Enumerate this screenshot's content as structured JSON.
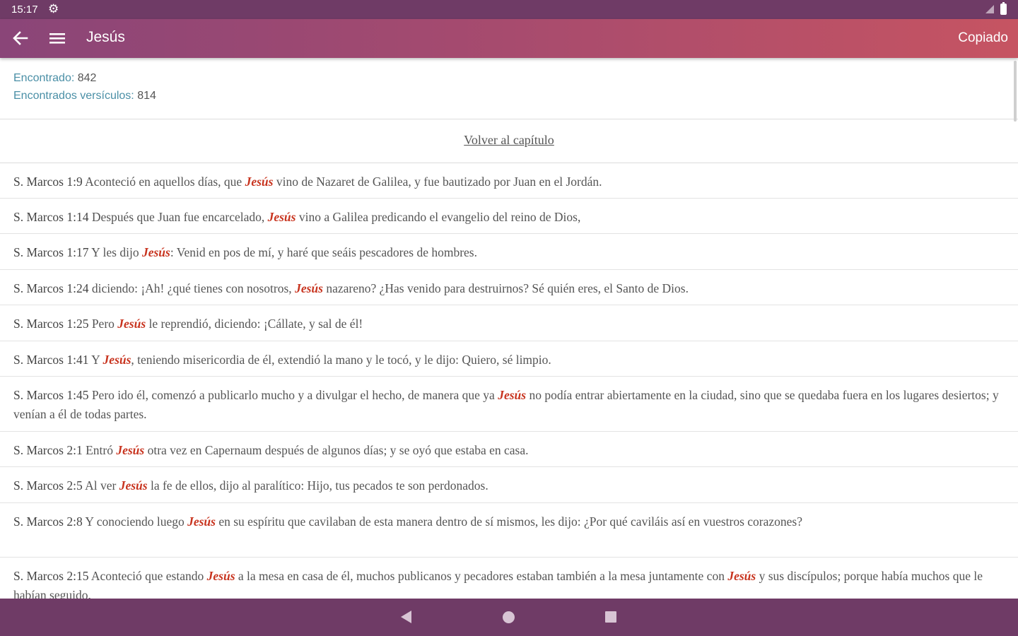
{
  "status_bar": {
    "time": "15:17"
  },
  "app_bar": {
    "title": "Jesús",
    "copy_label": "Copiado"
  },
  "stats": {
    "found_label": "Encontrado:",
    "found_value": "842",
    "verses_label": "Encontrados versículos:",
    "verses_value": "814"
  },
  "back_link": "Volver al capítulo",
  "results": [
    {
      "ref": "S. Marcos 1:9",
      "parts": [
        " Aconteció en aquellos días, que ",
        "Jesús",
        " vino de Nazaret de Galilea, y fue bautizado por Juan en el Jordán."
      ]
    },
    {
      "ref": "S. Marcos 1:14",
      "parts": [
        " Después que Juan fue encarcelado, ",
        "Jesús",
        " vino a Galilea predicando el evangelio del reino de Dios,"
      ]
    },
    {
      "ref": "S. Marcos 1:17",
      "parts": [
        " Y les dijo ",
        "Jesús",
        ": Venid en pos de mí, y haré que seáis pescadores de hombres."
      ]
    },
    {
      "ref": "S. Marcos 1:24",
      "parts": [
        " diciendo: ¡Ah! ¿qué tienes con nosotros, ",
        "Jesús",
        " nazareno? ¿Has venido para destruirnos? Sé quién eres, el Santo de Dios."
      ]
    },
    {
      "ref": "S. Marcos 1:25",
      "parts": [
        " Pero ",
        "Jesús",
        " le reprendió, diciendo: ¡Cállate, y sal de él!"
      ]
    },
    {
      "ref": "S. Marcos 1:41",
      "parts": [
        " Y ",
        "Jesús",
        ", teniendo misericordia de él, extendió la mano y le tocó, y le dijo: Quiero, sé limpio."
      ]
    },
    {
      "ref": "S. Marcos 1:45",
      "parts": [
        " Pero ido él, comenzó a publicarlo mucho y a divulgar el hecho, de manera que ya ",
        "Jesús",
        " no podía entrar abiertamente en la ciudad, sino que se quedaba fuera en los lugares desiertos; y venían a él de todas partes."
      ]
    },
    {
      "ref": "S. Marcos 2:1",
      "parts": [
        " Entró ",
        "Jesús",
        " otra vez en Capernaum después de algunos días; y se oyó que estaba en casa."
      ]
    },
    {
      "ref": "S. Marcos 2:5",
      "parts": [
        " Al ver ",
        "Jesús",
        " la fe de ellos, dijo al paralítico: Hijo, tus pecados te son perdonados."
      ]
    },
    {
      "ref": "S. Marcos 2:8",
      "parts": [
        " Y conociendo luego ",
        "Jesús",
        " en su espíritu que cavilaban de esta manera dentro de sí mismos, les dijo: ¿Por qué caviláis así en vuestros corazones?"
      ]
    },
    {
      "ref": "S. Marcos 2:15",
      "parts": [
        " Aconteció que estando ",
        "Jesús",
        " a la mesa en casa de él, muchos publicanos y pecadores estaban también a la mesa juntamente con ",
        "Jesús",
        " y sus discípulos; porque había muchos que le habían seguido."
      ]
    }
  ]
}
